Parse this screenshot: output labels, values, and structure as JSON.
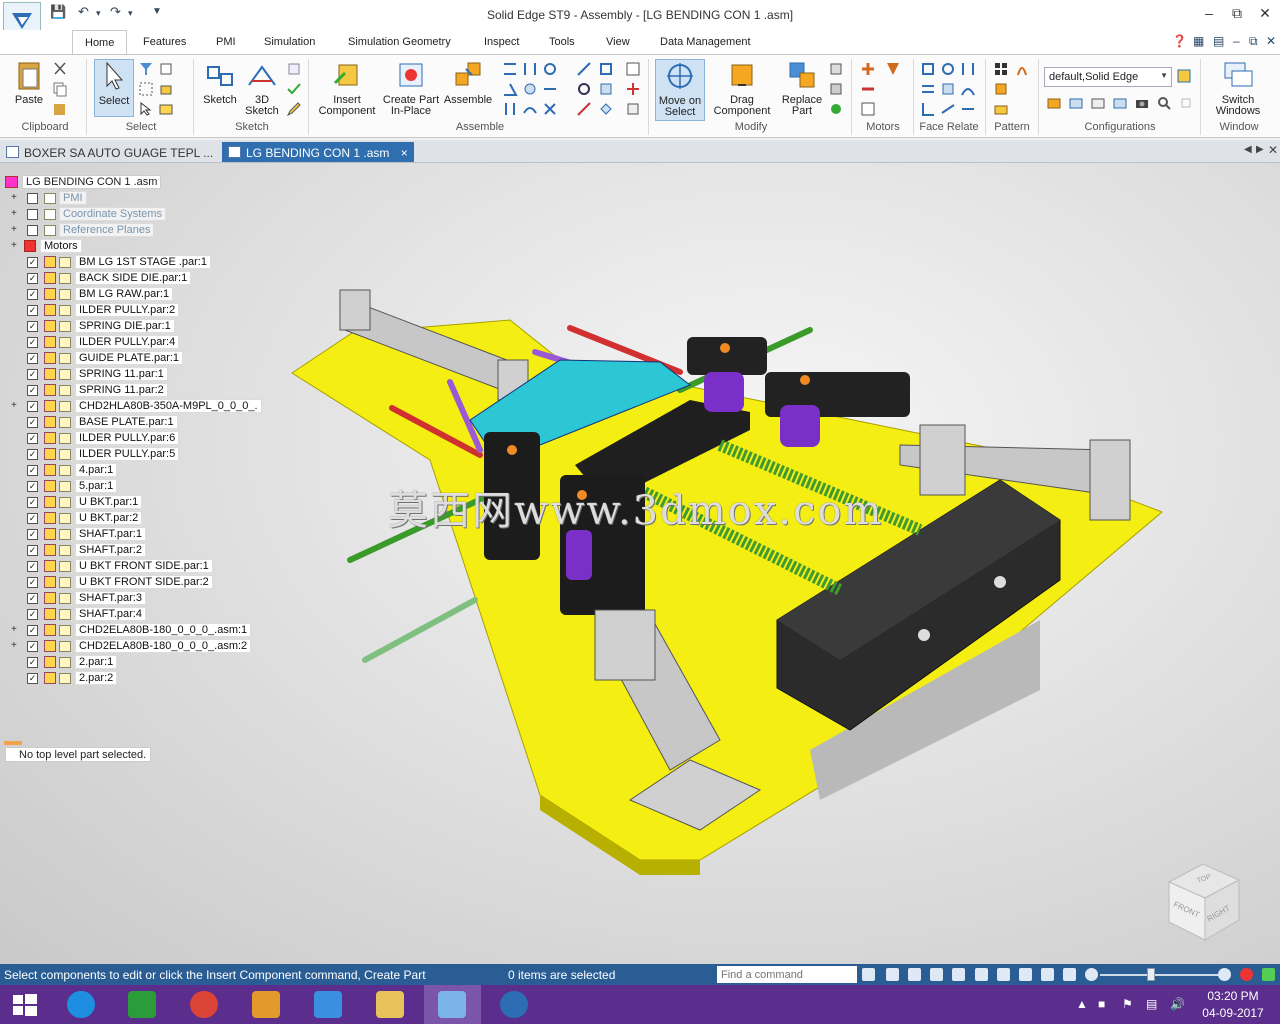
{
  "window": {
    "title": "Solid Edge ST9 - Assembly - [LG BENDING CON 1 .asm]"
  },
  "ribbon": {
    "tabs": [
      {
        "label": "Home"
      },
      {
        "label": "Features"
      },
      {
        "label": "PMI"
      },
      {
        "label": "Simulation"
      },
      {
        "label": "Simulation Geometry"
      },
      {
        "label": "Inspect"
      },
      {
        "label": "Tools"
      },
      {
        "label": "View"
      },
      {
        "label": "Data Management"
      }
    ],
    "groups": {
      "clipboard": {
        "label": "Clipboard",
        "paste": "Paste"
      },
      "select": {
        "label": "Select",
        "select": "Select"
      },
      "sketch": {
        "label": "Sketch",
        "sketch": "Sketch",
        "sketch3d_l1": "3D",
        "sketch3d_l2": "Sketch"
      },
      "assemble": {
        "label": "Assemble",
        "insert_l1": "Insert",
        "insert_l2": "Component",
        "create_l1": "Create Part",
        "create_l2": "In-Place",
        "assemble": "Assemble"
      },
      "modify": {
        "label": "Modify",
        "move_l1": "Move on",
        "move_l2": "Select",
        "drag_l1": "Drag",
        "drag_l2": "Component",
        "replace_l1": "Replace",
        "replace_l2": "Part"
      },
      "motors": {
        "label": "Motors"
      },
      "face_relate": {
        "label": "Face Relate"
      },
      "pattern": {
        "label": "Pattern"
      },
      "configurations": {
        "label": "Configurations",
        "current": "default,Solid Edge"
      },
      "window": {
        "label": "Window",
        "switch_l1": "Switch",
        "switch_l2": "Windows"
      }
    }
  },
  "documents": {
    "tabs": [
      {
        "label": "BOXER SA AUTO GUAGE TEPL ...",
        "close": "×"
      },
      {
        "label": "LG BENDING CON 1 .asm",
        "close": "×"
      }
    ]
  },
  "tree": {
    "root": "LG BENDING CON 1 .asm",
    "groups": [
      {
        "label": "PMI"
      },
      {
        "label": "Coordinate Systems"
      },
      {
        "label": "Reference Planes"
      },
      {
        "label": "Motors"
      }
    ],
    "items": [
      {
        "label": "BM LG 1ST STAGE .par:1",
        "expandable": false
      },
      {
        "label": "BACK SIDE DIE.par:1",
        "expandable": false
      },
      {
        "label": "BM LG RAW.par:1",
        "expandable": false
      },
      {
        "label": "ILDER PULLY.par:2",
        "expandable": false
      },
      {
        "label": "SPRING DIE.par:1",
        "expandable": false
      },
      {
        "label": "ILDER PULLY.par:4",
        "expandable": false
      },
      {
        "label": "GUIDE PLATE.par:1",
        "expandable": false
      },
      {
        "label": "SPRING 11.par:1",
        "expandable": false
      },
      {
        "label": "SPRING 11.par:2",
        "expandable": false
      },
      {
        "label": "CHD2HLA80B-350A-M9PL_0_0_0_.",
        "expandable": true
      },
      {
        "label": "BASE PLATE.par:1",
        "expandable": false
      },
      {
        "label": "ILDER PULLY.par:6",
        "expandable": false
      },
      {
        "label": "ILDER PULLY.par:5",
        "expandable": false
      },
      {
        "label": "4.par:1",
        "expandable": false
      },
      {
        "label": "5.par:1",
        "expandable": false
      },
      {
        "label": "U BKT.par:1",
        "expandable": false
      },
      {
        "label": "U BKT.par:2",
        "expandable": false
      },
      {
        "label": "SHAFT.par:1",
        "expandable": false
      },
      {
        "label": "SHAFT.par:2",
        "expandable": false
      },
      {
        "label": "U BKT FRONT SIDE.par:1",
        "expandable": false
      },
      {
        "label": "U BKT FRONT SIDE.par:2",
        "expandable": false
      },
      {
        "label": "SHAFT.par:3",
        "expandable": false
      },
      {
        "label": "SHAFT.par:4",
        "expandable": false
      },
      {
        "label": "CHD2ELA80B-180_0_0_0_.asm:1",
        "expandable": true
      },
      {
        "label": "CHD2ELA80B-180_0_0_0_.asm:2",
        "expandable": true
      },
      {
        "label": "2.par:1",
        "expandable": false
      },
      {
        "label": "2.par:2",
        "expandable": false
      }
    ],
    "selection_status": "No top level part selected."
  },
  "viewport": {
    "watermark": "莫西网www.3dmox.com",
    "viewcube": {
      "top": "TOP",
      "front": "FRONT",
      "right": "RIGHT"
    }
  },
  "statusbar": {
    "message": "Select components to edit or click the Insert Component command, Create Part",
    "selection_count": "0 items are selected",
    "find_placeholder": "Find a command"
  },
  "taskbar": {
    "time": "03:20 PM",
    "date": "04-09-2017"
  },
  "colors": {
    "base_plate": "#f5ee12",
    "blocks": "#2b2b2b",
    "cyan_die": "#2cc6d4",
    "springs": "#7a2fc8",
    "threaded_rods": "#3a9a2a",
    "statusbar": "#2a5d94",
    "taskbar": "#5b2d8c"
  }
}
